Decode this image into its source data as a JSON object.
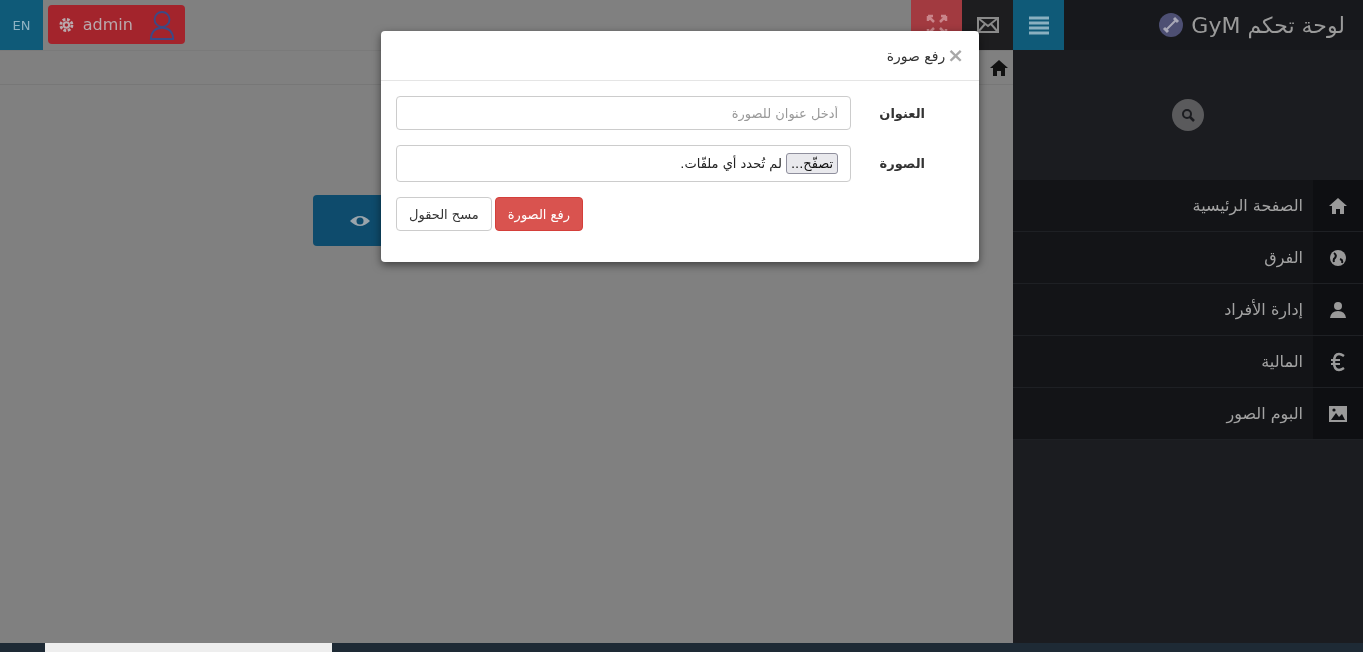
{
  "topbar": {
    "language": "EN",
    "user": {
      "name": "admin"
    },
    "brand": "لوحة تحكم GyM"
  },
  "sidebar": {
    "items": [
      {
        "label": "الصفحة الرئيسية"
      },
      {
        "label": "الفرق"
      },
      {
        "label": "إدارة الأفراد"
      },
      {
        "label": "المالية"
      },
      {
        "label": "البوم الصور"
      }
    ]
  },
  "modal": {
    "title": "رفع صورة",
    "close": "×",
    "fields": [
      {
        "kind": "text",
        "label": "العنوان",
        "placeholder": "أدخل عنوان للصورة"
      },
      {
        "kind": "file",
        "label": "الصورة",
        "button": "تصفّح...",
        "status": "لم تُحدد أي ملفّات."
      }
    ],
    "buttons": [
      {
        "label": "رفع الصورة",
        "kind": "primary"
      },
      {
        "label": "مسح الحقول",
        "kind": "default"
      }
    ]
  }
}
